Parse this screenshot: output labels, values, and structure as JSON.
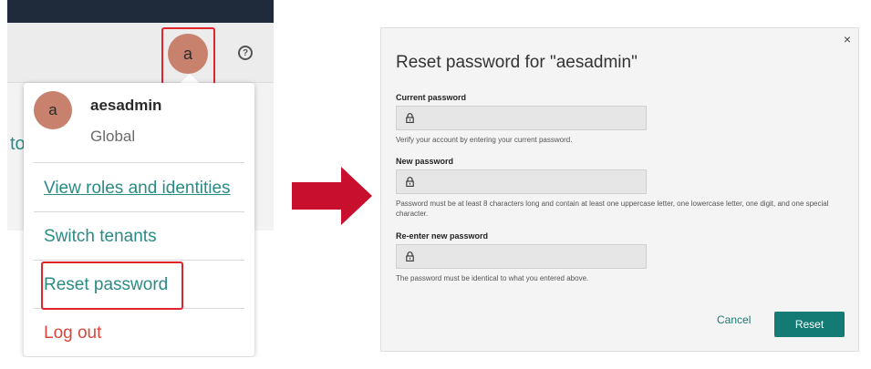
{
  "left_panel": {
    "avatar_letter": "a",
    "help_icon": "help-circle-icon",
    "background_fragment": "to",
    "menu": {
      "username": "aesadmin",
      "scope": "Global",
      "items": [
        {
          "label": "View roles and identities"
        },
        {
          "label": "Switch tenants"
        },
        {
          "label": "Reset password"
        },
        {
          "label": "Log out"
        }
      ]
    }
  },
  "dialog": {
    "title": "Reset password for \"aesadmin\"",
    "close_label": "×",
    "fields": [
      {
        "label": "Current password",
        "help": "Verify your account by entering your current password."
      },
      {
        "label": "New password",
        "help": "Password must be at least 8 characters long and contain at least one uppercase letter, one lowercase letter, one digit, and one special character."
      },
      {
        "label": "Re-enter new password",
        "help": "The password must be identical to what you entered above."
      }
    ],
    "cancel_label": "Cancel",
    "submit_label": "Reset"
  },
  "colors": {
    "accent_teal": "#137b73",
    "link_teal": "#2a8b84",
    "danger": "#d9463a",
    "highlight_red": "#e0242c",
    "arrow": "#c8102e",
    "avatar": "#c8816d"
  }
}
